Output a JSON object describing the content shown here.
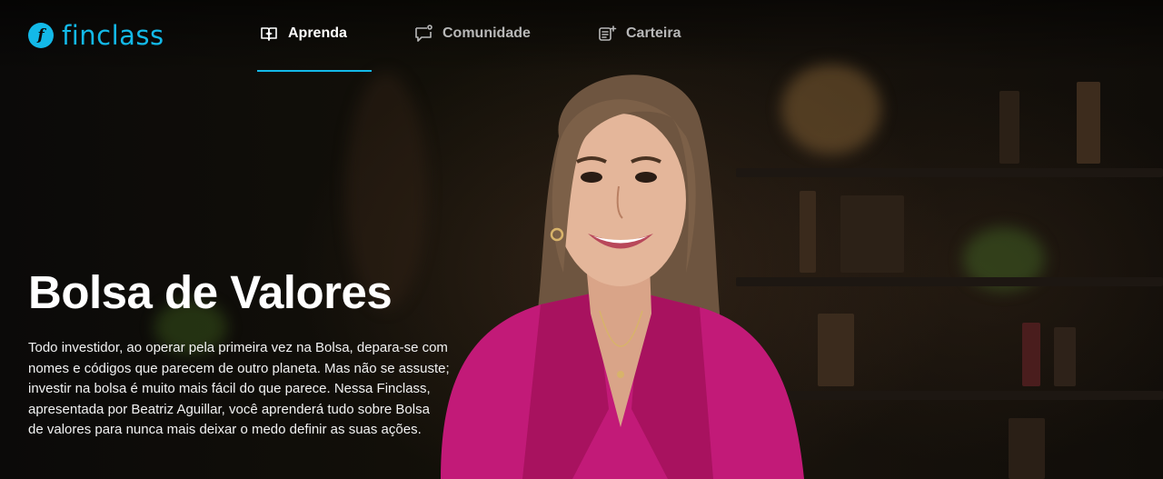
{
  "brand": {
    "name": "finclass",
    "color": "#13b9e8"
  },
  "nav": {
    "items": [
      {
        "label": "Aprenda",
        "icon": "graduation-cap-icon",
        "active": true
      },
      {
        "label": "Comunidade",
        "icon": "chat-bubble-icon",
        "active": false
      },
      {
        "label": "Carteira",
        "icon": "wallet-list-icon",
        "active": false
      }
    ]
  },
  "hero": {
    "title": "Bolsa de Valores",
    "description_lines": [
      "Todo investidor, ao operar pela primeira vez na Bolsa, depara-se com",
      "nomes e códigos que parecem de outro planeta. Mas não se assuste;",
      "investir na bolsa é muito mais fácil do que parece. Nessa Finclass,",
      "apresentada por Beatriz Aguillar, você aprenderá tudo sobre Bolsa",
      "de valores para nunca mais deixar o medo definir as suas ações."
    ],
    "accent_color": "#c21a78"
  }
}
